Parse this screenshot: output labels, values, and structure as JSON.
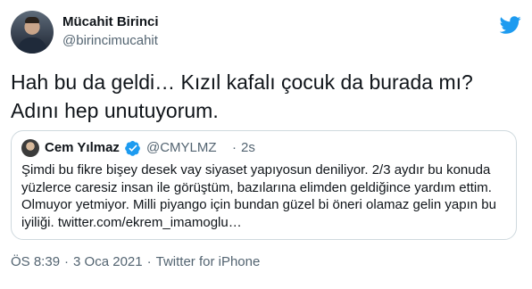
{
  "author": {
    "display_name": "Mücahit Birinci",
    "handle": "@birincimucahit"
  },
  "tweet": {
    "text": "Hah bu da geldi… Kızıl kafalı çocuk da burada mı? Adını hep unutuyorum."
  },
  "quoted": {
    "display_name": "Cem Yılmaz",
    "handle": "@CMYLMZ",
    "separator": "·",
    "time": "2s",
    "text": "Şimdi bu fikre bişey desek vay siyaset yapıyosun deniliyor. 2/3 aydır bu konuda yüzlerce caresiz insan ile görüştüm, bazılarına elimden geldiğince yardım ettim. Olmuyor yetmiyor. Milli piyango için bundan güzel bi öneri olamaz gelin yapın bu iyiliği. twitter.com/ekrem_imamoglu…"
  },
  "meta": {
    "time": "ÖS 8:39",
    "separator1": "·",
    "date": "3 Oca 2021",
    "separator2": "·",
    "source": "Twitter for iPhone"
  },
  "colors": {
    "brand_blue": "#1d9bf0",
    "text_primary": "#0f1419",
    "text_secondary": "#536471",
    "border": "#cfd9de"
  },
  "icons": {
    "logo": "twitter-bird-icon",
    "verified": "verified-badge-icon"
  }
}
